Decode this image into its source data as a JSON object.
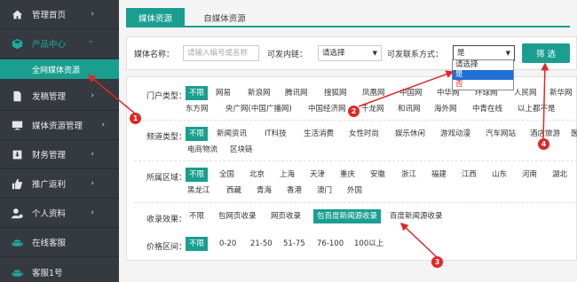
{
  "sidebar": {
    "items": [
      {
        "label": "管理首页",
        "icon": "home-icon",
        "arrow": "›"
      },
      {
        "label": "产品中心",
        "icon": "cube-icon",
        "arrow": "⌄"
      },
      {
        "label": "发稿管理",
        "icon": "document-icon",
        "arrow": "›"
      },
      {
        "label": "媒体资源管理",
        "icon": "monitor-icon",
        "arrow": "›"
      },
      {
        "label": "财务管理",
        "icon": "download-box-icon",
        "arrow": "›"
      },
      {
        "label": "推广返利",
        "icon": "thumbs-up-icon",
        "arrow": "›"
      },
      {
        "label": "个人资料",
        "icon": "user-gear-icon",
        "arrow": "›"
      },
      {
        "label": "在线客服",
        "icon": "android-icon",
        "arrow": ""
      },
      {
        "label": "客服1号",
        "icon": "android-icon",
        "arrow": ""
      }
    ],
    "sub_item": "全网媒体资源"
  },
  "tabs": [
    "媒体资源",
    "自媒体资源"
  ],
  "filters": {
    "media_name_label": "媒体名称：",
    "media_name_placeholder": "请输入编号或名称",
    "link_label": "可发内链：",
    "link_value": "请选择",
    "contact_label": "可发联系方式：",
    "contact_value": "是",
    "contact_options": [
      "请选择",
      "是",
      "否"
    ],
    "filter_button": "筛 选"
  },
  "portal": {
    "label": "门户类型：",
    "row1": [
      "不限",
      "网易",
      "新浪网",
      "腾讯网",
      "搜狐网",
      "凤凰网",
      "中国网",
      "中华网",
      "环球网",
      "人民网",
      "新华网"
    ],
    "row2": [
      "东方网",
      "央广网(中国广播网)",
      "中国经济网",
      "千龙网",
      "和讯网",
      "海外网",
      "中青在线",
      "以上都不是"
    ]
  },
  "channel": {
    "label": "频道类型：",
    "row1": [
      "不限",
      "新闻资讯",
      "IT科技",
      "生活消费",
      "女性时尚",
      "娱乐休闲",
      "游戏动漫",
      "汽车网站",
      "酒店旅游",
      "医"
    ],
    "row2": [
      "电商物流",
      "区块链"
    ]
  },
  "region": {
    "label": "所属区域：",
    "row1": [
      "不限",
      "全国",
      "北京",
      "上海",
      "天津",
      "重庆",
      "安徽",
      "浙江",
      "福建",
      "江西",
      "山东",
      "河南",
      "湖北"
    ],
    "row2": [
      "黑龙江",
      "西藏",
      "青海",
      "香港",
      "澳门",
      "外国"
    ]
  },
  "include": {
    "label": "收录效果：",
    "options": [
      "不限",
      "包网页收录",
      "网页收录",
      "包百度新闻源收录",
      "百度新闻源收录"
    ]
  },
  "price": {
    "label": "价格区间：",
    "options": [
      "不限",
      "0-20",
      "21-50",
      "51-75",
      "76-100",
      "100以上"
    ]
  },
  "annotations": [
    "1",
    "2",
    "3",
    "4"
  ],
  "colors": {
    "accent": "#1a9e90",
    "sidebar": "#353a40",
    "annotation": "#e02828"
  }
}
